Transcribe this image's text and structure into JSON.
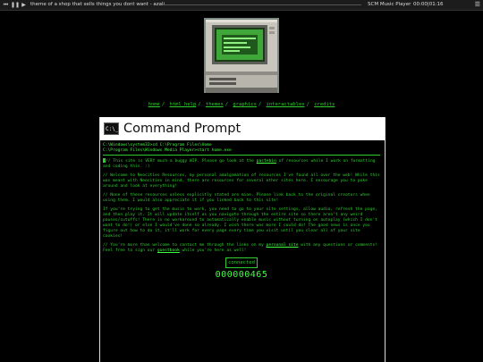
{
  "player": {
    "track_title": "theme of a shop that sells things you dont want - azali",
    "player_name": "SCM Music Player",
    "time": "00:00|01:16",
    "progress_fraction": 0.0,
    "controls": [
      "prev-icon",
      "pause-icon",
      "next-icon",
      "menu-icon"
    ]
  },
  "nav": {
    "items": [
      "home",
      "html help",
      "themes",
      "graphics",
      "interactables",
      "credits"
    ]
  },
  "window": {
    "title": "Command Prompt",
    "icon_text": "C:\\_",
    "cmd1": "C:\\Windows\\system32>cd C:\\Program Files\\Home",
    "cmd2": "C:\\Program Files\\Windows Media Player>start home.exe",
    "p1_a": "// This site is VERY much a buggy WIP. Please go look at the ",
    "p1_link": "pastebin",
    "p1_b": " of resources while I work on formatting and coding this. :)",
    "p2": "// Welcome to Neocities Resources, my personal amalgamation of resources I've found all over the web! While this was meant with Neocities in mind, there are resources for several other sites here. I encourage you to poke around and look at everything!",
    "p3": "// None of these resources unless explicitly stated are mine. Please link back to the original creators when using them. I would also appreciate it if you linked back to this site!",
    "p4": "If you're trying to get the music to work, you need to go to your site settings, allow audio, refresh the page, and then play it. It will update itself as you navigate through the entire site so there aren't any weird pauses/cutoffs! There is no workaround to automatically enable music without turning on autoplay (which I don't want to do!) or else I would've done so already. I wish there was more I could do! The good news is once you figure out how to do it, it'll work for every page every time you visit until you clear all of your site cookies!",
    "p5_a": "// You're more than welcome to contact me through the links on my ",
    "p5_link1": "personal site",
    "p5_b": " with any questions or comments! Feel free to sign our ",
    "p5_link2": "guestbook",
    "p5_c": " while you're here as well!",
    "counter_label": "connected",
    "counter_value": "000000465"
  },
  "colors": {
    "terminal_green": "#2ecc2e",
    "background": "#000000"
  }
}
